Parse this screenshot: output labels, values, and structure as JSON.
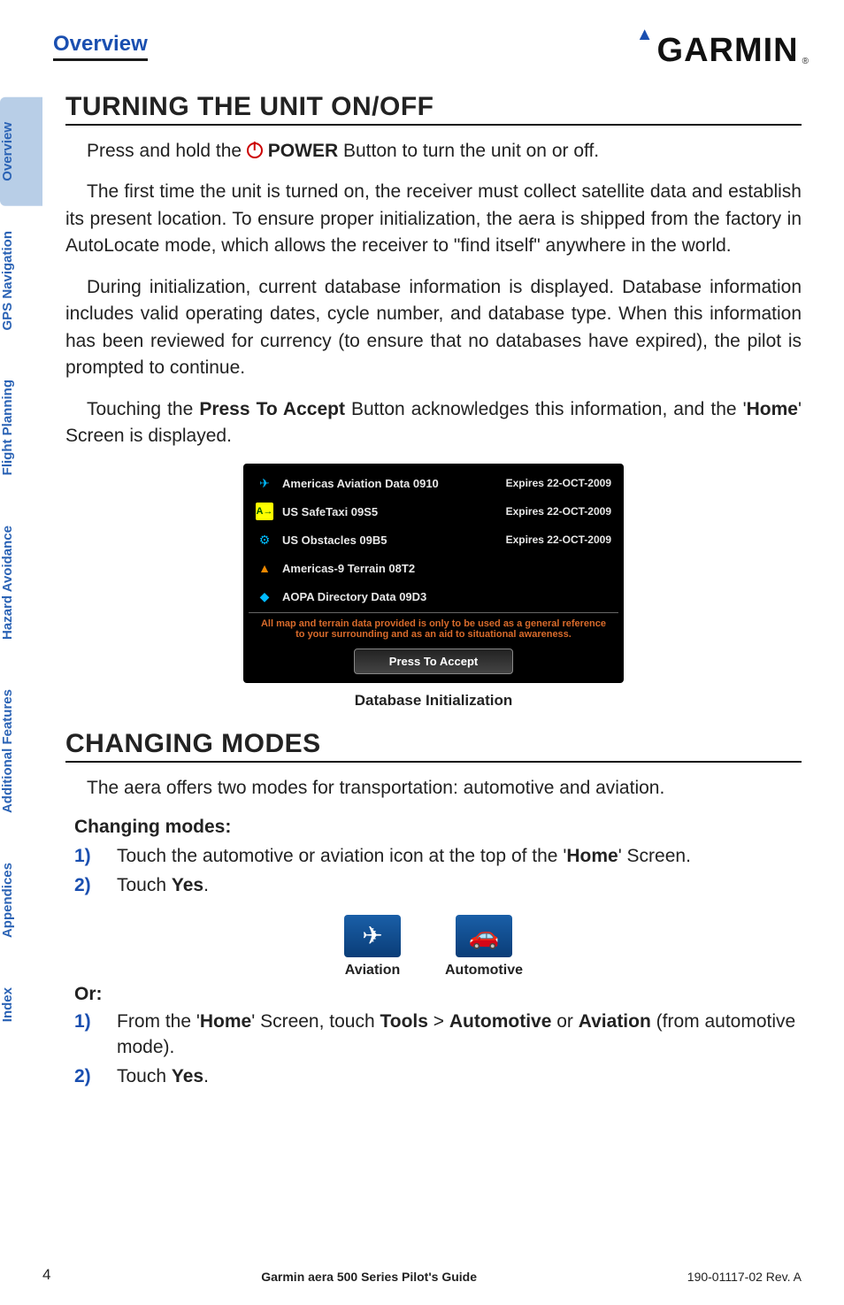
{
  "header": {
    "section_label": "Overview",
    "logo_text": "GARMIN",
    "logo_reg": "®"
  },
  "tabs": {
    "items": [
      {
        "label": "Overview",
        "active": true
      },
      {
        "label": "GPS Navigation",
        "active": false
      },
      {
        "label": "Flight Planning",
        "active": false
      },
      {
        "label": "Hazard Avoidance",
        "active": false
      },
      {
        "label": "Additional Features",
        "active": false
      },
      {
        "label": "Appendices",
        "active": false
      },
      {
        "label": "Index",
        "active": false
      }
    ]
  },
  "section1": {
    "heading": "TURNING THE UNIT ON/OFF",
    "p1_a": "Press and hold the ",
    "p1_power": "POWER",
    "p1_b": " Button to turn the unit on or off.",
    "p2": "The first time the unit is turned on, the receiver must collect satellite data and establish its present location.  To ensure proper initialization, the aera is shipped from the factory in AutoLocate mode, which allows the receiver to \"find itself\" anywhere in the world.",
    "p3": "During initialization, current database information is displayed.  Database information includes valid operating dates, cycle number, and database type.  When this information has been reviewed for currency (to ensure that no databases have expired), the pilot is prompted to continue.",
    "p4_a": "Touching the ",
    "p4_btn": "Press To Accept",
    "p4_b": " Button acknowledges this information, and the '",
    "p4_home": "Home",
    "p4_c": "' Screen is displayed."
  },
  "db_screenshot": {
    "rows": [
      {
        "icon_bg": "#000",
        "icon_color": "#0bf",
        "icon": "✈",
        "name": "Americas Aviation Data 0910",
        "exp": "Expires 22-OCT-2009"
      },
      {
        "icon_bg": "#ff0",
        "icon_color": "#050",
        "icon": "A→",
        "name": "US SafeTaxi 09S5",
        "exp": "Expires 22-OCT-2009"
      },
      {
        "icon_bg": "#000",
        "icon_color": "#0bf",
        "icon": "⚙",
        "name": "US Obstacles 09B5",
        "exp": "Expires 22-OCT-2009"
      },
      {
        "icon_bg": "#000",
        "icon_color": "#e80",
        "icon": "▲",
        "name": "Americas-9 Terrain 08T2",
        "exp": ""
      },
      {
        "icon_bg": "#000",
        "icon_color": "#0bf",
        "icon": "◆",
        "name": "AOPA Directory Data 09D3",
        "exp": ""
      }
    ],
    "note1": "All map and terrain data provided is only to be used as a general reference",
    "note2": "to your surrounding and as an aid to situational awareness.",
    "button": "Press To Accept",
    "caption": "Database Initialization"
  },
  "section2": {
    "heading": "CHANGING MODES",
    "p1": "The aera offers two modes for transportation:  automotive and aviation.",
    "sub1": "Changing modes:",
    "step1_a": "Touch the automotive or aviation icon at the top of the '",
    "step1_home": "Home",
    "step1_b": "' Screen.",
    "step2_a": "Touch ",
    "step2_yes": "Yes",
    "step2_b": ".",
    "mode_aviation": "Aviation",
    "mode_automotive": "Automotive",
    "or": "Or:",
    "or_step1_a": "From the '",
    "or_step1_home": "Home",
    "or_step1_b": "' Screen, touch ",
    "or_step1_tools": "Tools",
    "or_step1_gt": " > ",
    "or_step1_auto": "Automotive",
    "or_step1_or": " or ",
    "or_step1_av": "Aviation",
    "or_step1_c": " (from automotive mode).",
    "or_step2_a": "Touch ",
    "or_step2_yes": "Yes",
    "or_step2_b": "."
  },
  "footer": {
    "page": "4",
    "center": "Garmin aera 500 Series Pilot's Guide",
    "right": "190-01117-02  Rev. A"
  }
}
